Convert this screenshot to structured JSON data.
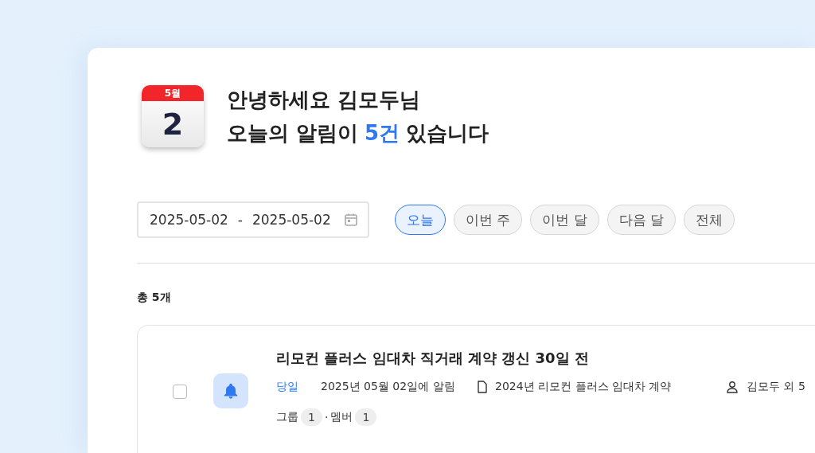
{
  "header": {
    "calendar": {
      "month": "5월",
      "day": "2"
    },
    "greeting": "안녕하세요 김모두님",
    "summary_before": "오늘의 알림이",
    "summary_count": "5건",
    "summary_after": "있습니다"
  },
  "date_range": {
    "start": "2025-05-02",
    "separator": "-",
    "end": "2025-05-02"
  },
  "period_filters": [
    {
      "label": "오늘",
      "selected": true
    },
    {
      "label": "이번 주",
      "selected": false
    },
    {
      "label": "이번 달",
      "selected": false
    },
    {
      "label": "다음 달",
      "selected": false
    },
    {
      "label": "전체",
      "selected": false
    }
  ],
  "total": "총 5개",
  "notifications": [
    {
      "title": "리모컨 플러스 임대차 직거래 계약 갱신 30일 전",
      "checked": false,
      "due": "당일",
      "alert": "2025년 05월 02일에 알림",
      "document": "2024년 리모컨 플러스 임대차 계약",
      "assignee": "김모두 외 5",
      "group_label": "그룹",
      "group_count": "1",
      "separator": "·",
      "member_label": "멤버",
      "member_count": "1"
    }
  ]
}
